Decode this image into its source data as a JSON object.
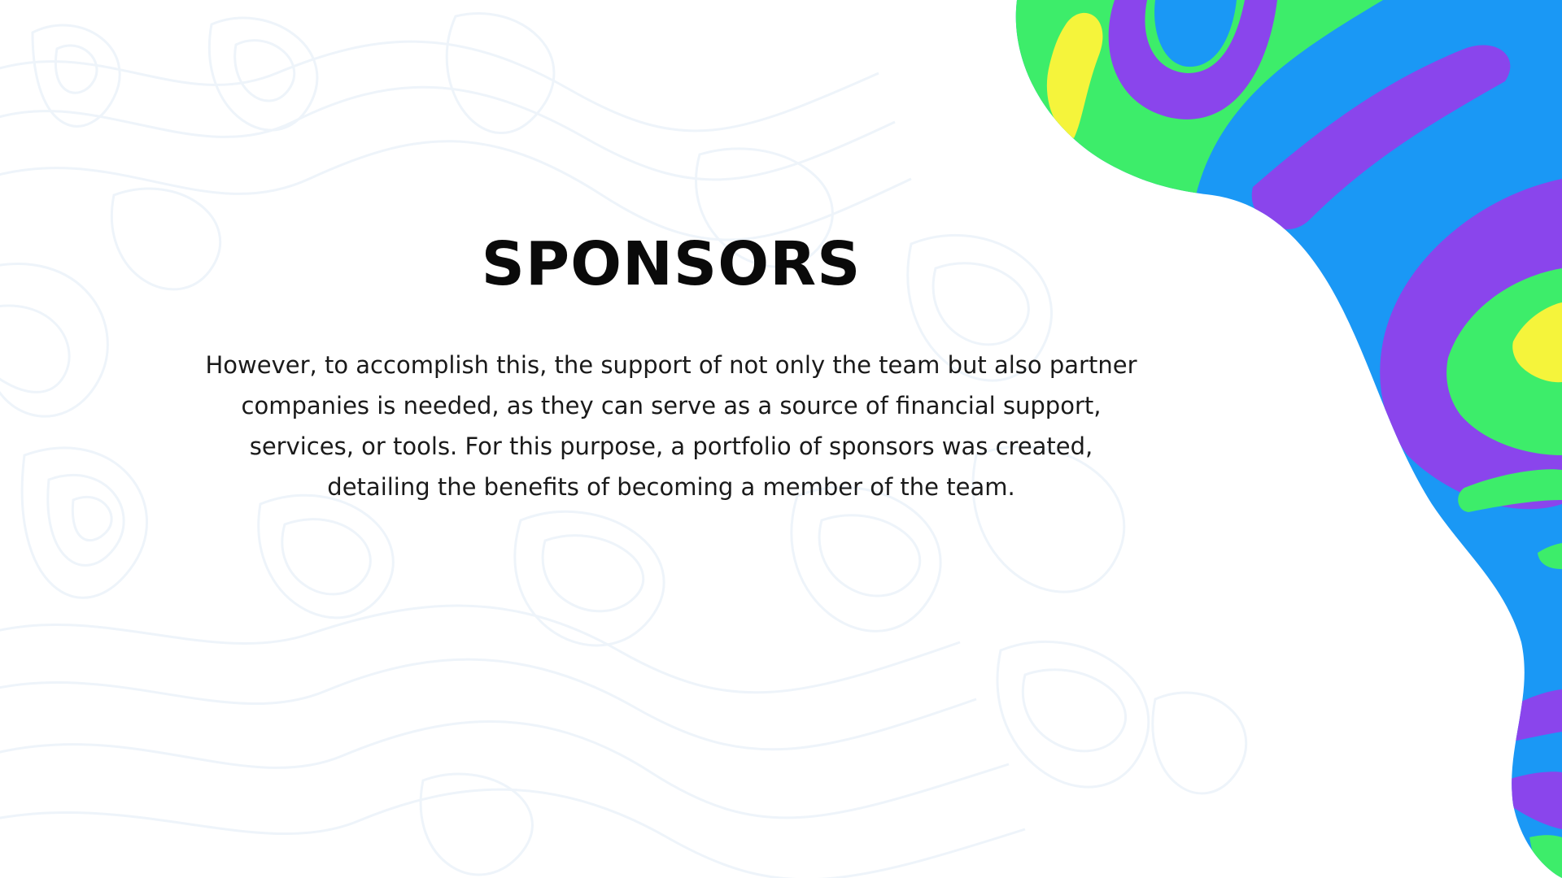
{
  "slide": {
    "title": "SPONSORS",
    "body": "However, to accomplish this, the support of not only the team but also partner companies is needed, as they can serve as a source of financial support, services, or tools. For this purpose, a portfolio of sponsors was created, detailing the benefits of becoming a member of the team."
  },
  "colors": {
    "background": "#ffffff",
    "topo_lines": "#eef4fa",
    "blue": "#1a98f5",
    "purple": "#8a45ec",
    "green": "#3ded6a",
    "yellow": "#f5f43b",
    "text": "#1a1a1a"
  }
}
